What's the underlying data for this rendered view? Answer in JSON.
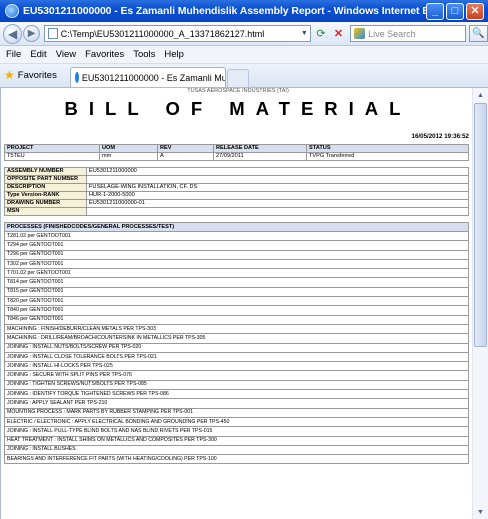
{
  "window": {
    "title": "EU5301211000000 - Es Zamanli Muhendislik Assembly Report - Windows Internet Explorer provided by TUSAS - INTERNET HIZMETLERI",
    "minimize": "_",
    "maximize": "□",
    "close": "✕"
  },
  "address": {
    "url": "C:\\Temp\\EU5301211000000_A_13371862127.html",
    "search_placeholder": "Live Search"
  },
  "menu": [
    "File",
    "Edit",
    "View",
    "Favorites",
    "Tools",
    "Help"
  ],
  "favorites": {
    "label": "Favorites"
  },
  "tab": {
    "label": "EU5301211000000 - Es Zamanli Muhendislik Assembly ..."
  },
  "report": {
    "top_text": "TUSAS AEROSPACE INDUSTRIES (TAI)",
    "title": "BILL OF MATERIAL",
    "date": "16/05/2012 19:36:52",
    "project_headers": [
      "PROJECT",
      "UOM",
      "REV",
      "RELEASE DATE",
      "STATUS"
    ],
    "project_row": [
      "T5TEU",
      "mm",
      "A",
      "27/09/2011",
      "TVPG Transferred"
    ],
    "assembly": [
      {
        "label": "ASSEMBLY NUMBER",
        "value": "EU5301211000000"
      },
      {
        "label": "OPPOSITE PART NUMBER",
        "value": ""
      },
      {
        "label": "DESCRIPTION",
        "value": "FUSELAGE-WING INSTALLATION, CF. DS"
      },
      {
        "label": "Type Version-RANK",
        "value": "HUR-1-2000-5000"
      },
      {
        "label": "DRAWING NUMBER",
        "value": "EU5301211000000-01"
      },
      {
        "label": "MSN",
        "value": ""
      }
    ],
    "process_header": "PROCESSES (FINISHEDCODES/GENERAL PROCESSES/TEST)",
    "processes": [
      "T281.02 per GENTOOT001",
      "T294 per GENTOOT001",
      "T296 per GENTOOT001",
      "T302 per GENTOOT001",
      "T701.02 per GENTOOT001",
      "T814 per GENTOOT001",
      "T815 per GENTOOT001",
      "T820 per GENTOOT001",
      "T840 per GENTOOT001",
      "T846 per GENTOOT001",
      "MACHINING : FINISH/DEBURR/CLEAN METALS PER TPS-303",
      "MACHINING : DRILL/REAM/BROACH/COUNTERSINK IN METALLICS PER TPS-305",
      "JOINING : INSTALL NUTS/BOLTS/SCREW PER TPS-020",
      "JOINING : INSTALL CLOSE TOLERANCE BOLTS PER TPS-021",
      "JOINING : INSTALL HI-LOCKS PER TPS-025",
      "JOINING : SECURE WITH SPLIT PINS PER TPS-076",
      "JOINING : TIGHTEN SCREWS/NUTS/BOLTS PER TPS-085",
      "JOINING : IDENTIFY TORQUE TIGHTENED SCREWS PER TPS-086",
      "JOINING : APPLY SEALANT PER TPS-210",
      "MOUNTING PROCESS : MARK PARTS BY RUBBER STAMPING PER TPS-001",
      "ELECTRIC / ELECTRONIC : APPLY ELECTRICAL BONDING AND GROUNDING PER TPS-450",
      "JOINING : INSTALL PULL-TYPE BLIND BOLTS AND NAS BLIND RIVETS PER TPS-015",
      "HEAT TREATMENT : INSTALL SHIMS ON METALLICS AND COMPOSITES PER TPS-300",
      "JOINING : INSTALL BUSHES",
      "BEARINGS AND INTERFERENCE FIT PARTS (WITH HEATING/COOLING) PER TPS-100"
    ]
  },
  "colors": {
    "title_bar": "#0a4fd0",
    "header_blue": "#d6def0",
    "header_yellow": "#f6f2da"
  }
}
